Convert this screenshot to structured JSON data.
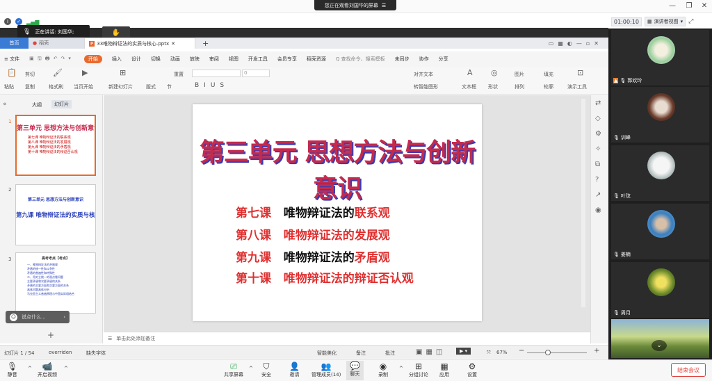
{
  "meeting": {
    "share_banner": "您正在观看刘国华的屏幕",
    "share_icon": "☰",
    "speaker_tip": "正在讲话: 刘国华;",
    "timer": "01:00:10",
    "viewer_label": "演讲者视图"
  },
  "wps": {
    "tabs": [
      {
        "label": "首页"
      },
      {
        "label": "稻壳"
      },
      {
        "label": "33唯物辩证法的实质与核心.pptx"
      }
    ],
    "menu": [
      "≡ 文件",
      "开始",
      "插入",
      "设计",
      "切换",
      "动画",
      "放映",
      "审阅",
      "视图",
      "开发工具",
      "会员专享",
      "稻壳资源",
      "Q 查找命令、搜索模板",
      "未同步",
      "协作",
      "分享"
    ],
    "ribbon_labels": [
      "粘贴",
      "剪切",
      "复制",
      "格式刷",
      "当页开始",
      "新建幻灯片",
      "版式",
      "节",
      "重置",
      "文本框",
      "形状",
      "排列",
      "图片",
      "填充",
      "轮廓",
      "演示工具"
    ],
    "font_size_sel": "0",
    "ribbon_extra": [
      "对齐文本",
      "转智能图形"
    ],
    "left_tabs": [
      "大纲",
      "幻灯片"
    ],
    "thumbs": [
      {
        "num": "1",
        "title": "第三单元 思想方法与创新意识",
        "lines": [
          "第七课 唯物辩证法的联系观",
          "第八课 唯物辩证法的发展观",
          "第九课 唯物辩证法的矛盾观",
          "第十课 唯物辩证法的辩证否认观"
        ]
      },
      {
        "num": "2",
        "title1": "第三单元 思想方法与创新意识",
        "title2": "第九课 唯物辩证法的实质与核心"
      },
      {
        "num": "3",
        "title": "高考考点【考点】",
        "lines": [
          "一、唯物辩证法的矛盾观",
          "矛盾的统一性和斗争性",
          "矛盾的普遍性和特殊性",
          "二、用对立统一的观点看问题",
          "主要矛盾和次要矛盾的关系",
          "矛盾的主要方面和次要方面的关系",
          "具体问题具体分析",
          "马克思主义普遍原理与中国实际相结合"
        ]
      }
    ],
    "comment_placeholder": "说点什么...",
    "add_slide": "+",
    "notes": "单击此处添加备注",
    "status": {
      "slide_pos": "幻灯片 1 / 54",
      "theme": "overriden",
      "font": "缺失字体",
      "beautify": "智能美化",
      "notes": "备注",
      "comment": "批注",
      "zoom": "67%"
    }
  },
  "slide": {
    "title": "第三单元  思想方法与创新意识",
    "lessons": [
      {
        "num": "第七课",
        "pre": "唯物辩证法的",
        "post": "联系观",
        "pre_color": "blk"
      },
      {
        "num": "第八课",
        "pre": "唯物辩证法的发展观",
        "post": "",
        "pre_color": "red"
      },
      {
        "num": "第九课",
        "pre": "唯物辩证法的",
        "post": "矛盾观",
        "pre_color": "blk"
      },
      {
        "num": "第十课",
        "pre": "唯物辩证法的辩证否认观",
        "post": "",
        "pre_color": "red"
      }
    ]
  },
  "participants": [
    {
      "name": "郭欢玲"
    },
    {
      "name": "训峰"
    },
    {
      "name": "叶玟"
    },
    {
      "name": "姜楠"
    },
    {
      "name": "周月"
    }
  ],
  "toolbar": {
    "items": [
      "静音",
      "开启视频",
      "共享屏幕",
      "安全",
      "邀请",
      "管理成员(14)",
      "聊天",
      "录制",
      "分组讨论",
      "应用",
      "设置"
    ],
    "end": "结束会议"
  }
}
